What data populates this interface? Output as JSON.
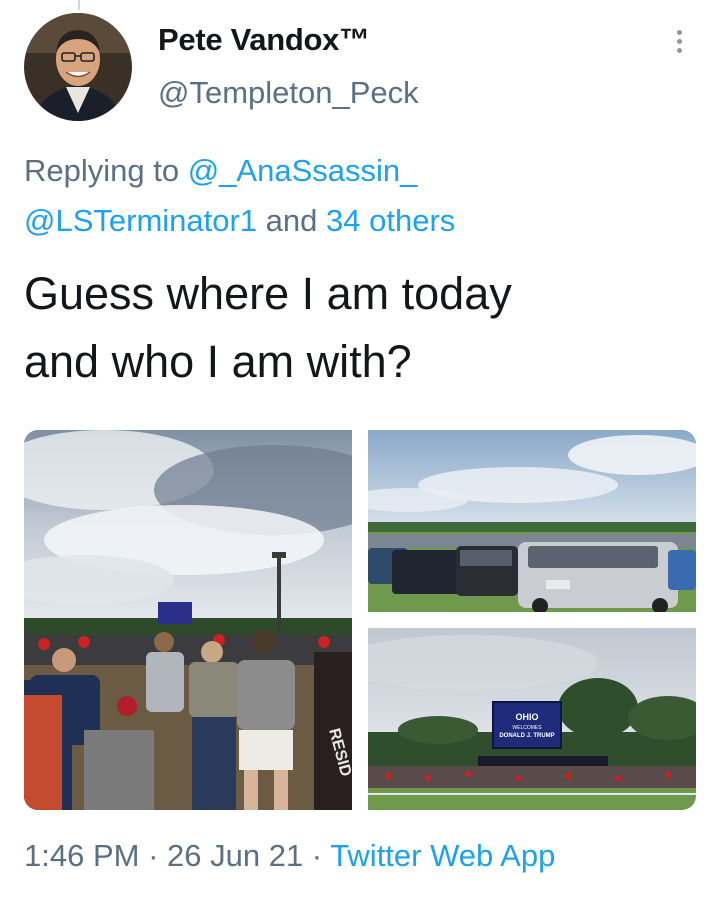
{
  "author": {
    "display_name": "Pete Vandox™",
    "handle": "@Templeton_Peck",
    "avatar_icon": "profile-photo"
  },
  "reply": {
    "prefix": "Replying to ",
    "mention1": "@_AnaSsassin_",
    "mention2": "@LSTerminator1",
    "joiner": " and ",
    "others": "34 others"
  },
  "tweet": {
    "text_line1": "Guess where I am today",
    "text_line2": "and who I am with?"
  },
  "media": {
    "photo1_sign": "",
    "photo1_shirt_text": "RESID",
    "photo3_sign_line1": "OHIO",
    "photo3_sign_line2": "WELCOMES",
    "photo3_sign_line3": "DONALD J. TRUMP"
  },
  "meta": {
    "time": "1:46 PM",
    "separator": " · ",
    "date": "26 Jun 21",
    "source": "Twitter Web App"
  },
  "colors": {
    "link": "#1da1f2",
    "secondary_text": "#5b7083",
    "primary_text": "#14171a"
  }
}
